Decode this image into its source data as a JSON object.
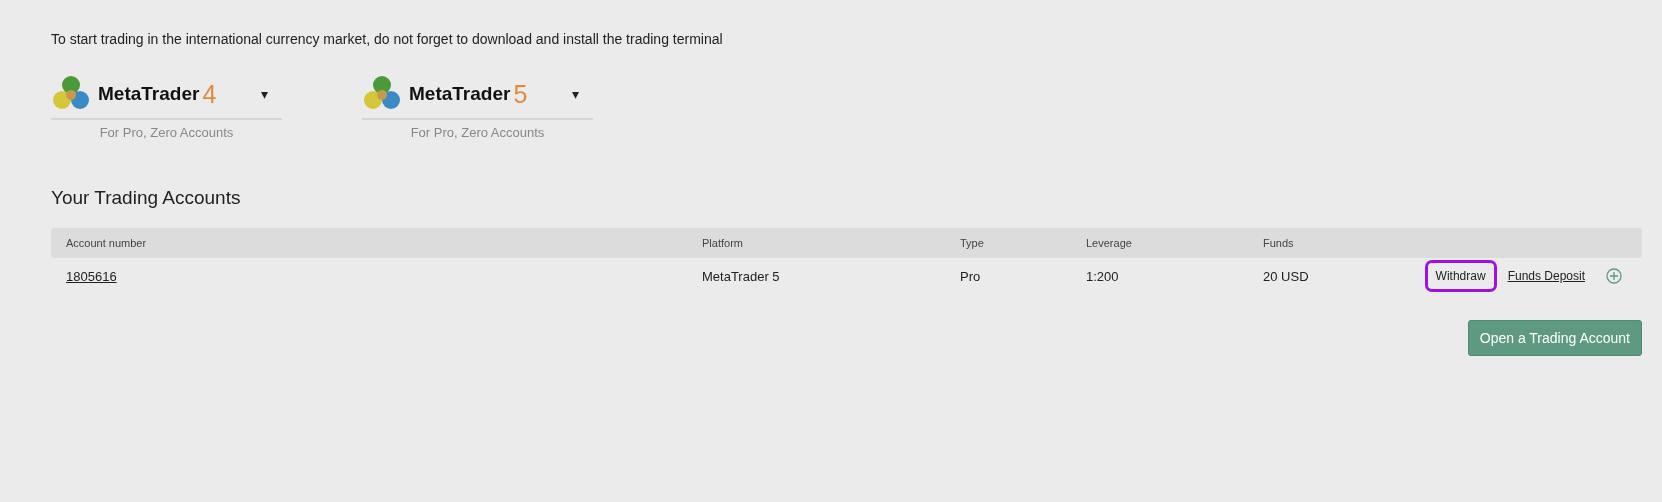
{
  "intro": "To start trading in the international currency market, do not forget to download and install the trading terminal",
  "platforms": [
    {
      "name": "MetaTrader",
      "version": "4",
      "caret": "▾",
      "note": "For Pro, Zero Accounts"
    },
    {
      "name": "MetaTrader",
      "version": "5",
      "caret": "▾",
      "note": "For Pro, Zero Accounts"
    }
  ],
  "accounts_title": "Your Trading Accounts",
  "table": {
    "columns": [
      "Account number",
      "Platform",
      "Type",
      "Leverage",
      "Funds"
    ],
    "rows": [
      {
        "account": "1805616",
        "platform": "MetaTrader 5",
        "type": "Pro",
        "leverage": "1:200",
        "funds": "20 USD",
        "actions": [
          {
            "label": "Withdraw",
            "kind": "plain",
            "highlighted": true
          },
          {
            "label": "Funds Deposit",
            "kind": "link",
            "highlighted": false
          }
        ]
      }
    ]
  },
  "open_button": "Open a Trading Account"
}
